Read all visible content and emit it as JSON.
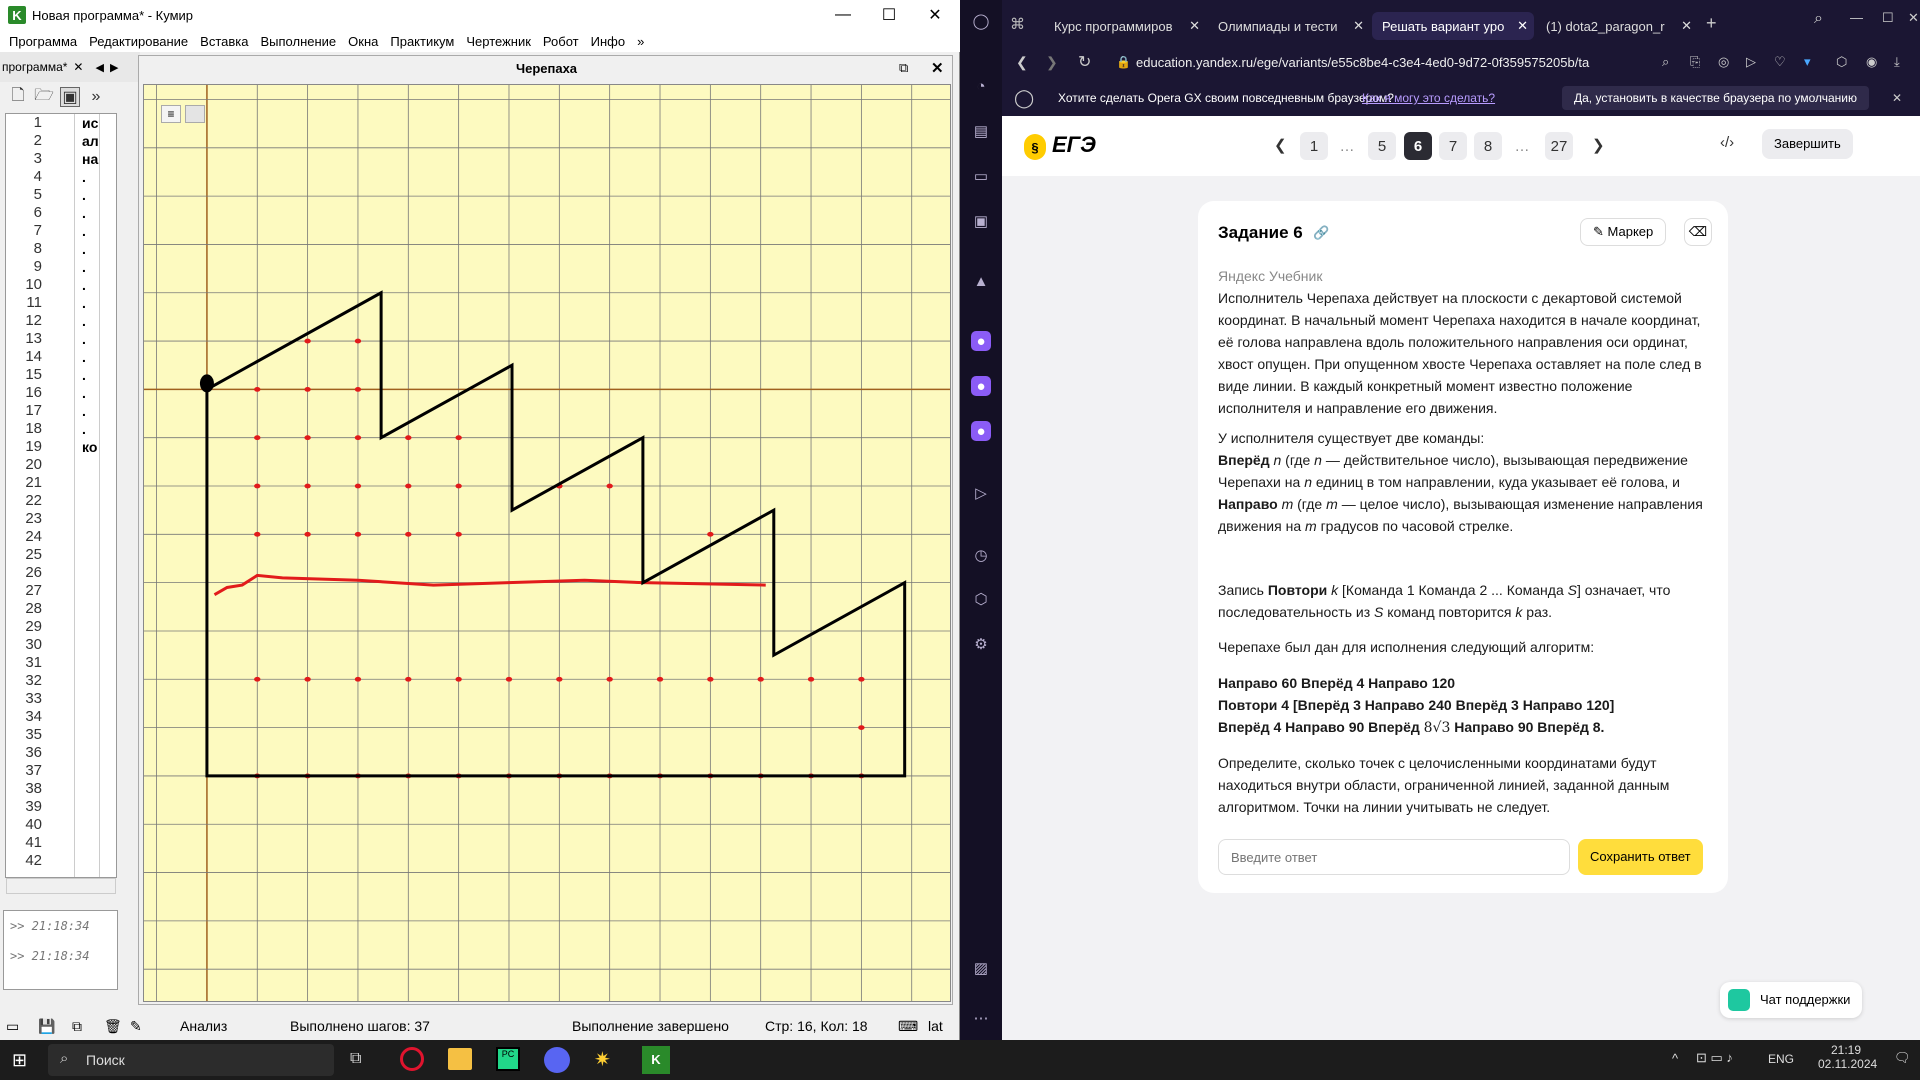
{
  "kumir": {
    "title": "Новая программа* - Кумир",
    "menu": [
      "Программа",
      "Редактирование",
      "Вставка",
      "Выполнение",
      "Окна",
      "Практикум",
      "Чертежник",
      "Робот",
      "Инфо",
      "»"
    ],
    "tab_label": "программа*",
    "line_numbers": [
      "1",
      "2",
      "3",
      "4",
      "5",
      "6",
      "7",
      "8",
      "9",
      "10",
      "11",
      "12",
      "13",
      "14",
      "15",
      "16",
      "17",
      "18",
      "19",
      "20",
      "21",
      "22",
      "23",
      "24",
      "25",
      "26",
      "27",
      "28",
      "29",
      "30",
      "31",
      "32",
      "33",
      "34",
      "35",
      "36",
      "37",
      "38",
      "39",
      "40",
      "41",
      "42"
    ],
    "code_lines": [
      "ис",
      "ал",
      "на",
      ".",
      ".",
      ".",
      ".",
      ".",
      ".",
      ".",
      ".",
      ".",
      ".",
      ".",
      ".",
      ".",
      ".",
      ".",
      "ко"
    ],
    "console_lines": [
      ">> 21:18:34",
      ">> 21:18:34"
    ],
    "turtle_panel_title": "Черепаха",
    "status": {
      "mode": "Анализ",
      "steps": "Выполнено шагов: 37",
      "state": "Выполнение завершено",
      "cursor": "Стр: 16, Кол: 18",
      "layout": "lat"
    }
  },
  "turtle_canvas": {
    "grid_step": 1,
    "origin": [
      0,
      0
    ],
    "x_range": [
      -1.25,
      14.8
    ],
    "y_range": [
      -12.7,
      6.3
    ],
    "path": [
      [
        0,
        0
      ],
      [
        3.46,
        2
      ],
      [
        3.46,
        -1
      ],
      [
        6.06,
        0.5
      ],
      [
        6.06,
        -2.5
      ],
      [
        8.66,
        -1
      ],
      [
        8.66,
        -4
      ],
      [
        11.26,
        -2.5
      ],
      [
        11.26,
        -5.5
      ],
      [
        13.86,
        -4
      ],
      [
        13.86,
        -8
      ],
      [
        0,
        -8
      ],
      [
        0,
        0
      ]
    ],
    "marker_points": [
      [
        1,
        -8
      ],
      [
        2,
        -8
      ],
      [
        3,
        -8
      ],
      [
        4,
        -8
      ],
      [
        5,
        -8
      ],
      [
        6,
        -8
      ],
      [
        7,
        -8
      ],
      [
        8,
        -8
      ],
      [
        9,
        -8
      ],
      [
        10,
        -8
      ],
      [
        11,
        -8
      ],
      [
        12,
        -8
      ],
      [
        13,
        -8
      ],
      [
        13,
        -7
      ],
      [
        1,
        -6
      ],
      [
        2,
        -6
      ],
      [
        3,
        -6
      ],
      [
        4,
        -6
      ],
      [
        5,
        -6
      ],
      [
        6,
        -6
      ],
      [
        7,
        -6
      ],
      [
        8,
        -6
      ],
      [
        9,
        -6
      ],
      [
        10,
        -6
      ],
      [
        11,
        -6
      ],
      [
        12,
        -6
      ],
      [
        13,
        -6
      ],
      [
        1,
        -3
      ],
      [
        2,
        -3
      ],
      [
        3,
        -3
      ],
      [
        4,
        -3
      ],
      [
        5,
        -3
      ],
      [
        1,
        -2
      ],
      [
        2,
        -2
      ],
      [
        3,
        -2
      ],
      [
        4,
        -2
      ],
      [
        5,
        -2
      ],
      [
        7,
        -2
      ],
      [
        1,
        -1
      ],
      [
        2,
        -1
      ],
      [
        3,
        -1
      ],
      [
        4,
        -1
      ],
      [
        5,
        -1
      ],
      [
        1,
        0
      ],
      [
        2,
        0
      ],
      [
        3,
        0
      ],
      [
        2,
        1
      ],
      [
        3,
        1
      ],
      [
        10,
        -3
      ],
      [
        7,
        -2
      ],
      [
        8,
        -2
      ]
    ]
  },
  "opera": {
    "tabs": [
      "Курс программиров",
      "Олимпиады и тести",
      "Решать вариант уро",
      "(1) dota2_paragon_r"
    ],
    "address": "education.yandex.ru/ege/variants/e55c8be4-c3e4-4ed0-9d72-0f359575205b/ta",
    "banner": {
      "question": "Хотите сделать Opera GX своим повседневным браузером?",
      "link": "Как я могу это сделать?",
      "button": "Да, установить в качестве браузера по умолчанию"
    }
  },
  "yandex": {
    "logo_text": "ЕГЭ",
    "pages": [
      "1",
      "…",
      "5",
      "6",
      "7",
      "8",
      "…",
      "27"
    ],
    "active_page": "6",
    "finish_label": "Завершить",
    "task_title": "Задание 6",
    "marker_label": "Маркер",
    "source": "Яндекс Учебник",
    "p1": "Исполнитель Черепаха действует на плоскости с декартовой системой координат. В начальный момент Черепаха находится в начале координат, её голова направлена вдоль положительного направления оси ординат, хвост опущен. При опущенном хвосте Черепаха оставляет на поле след в виде линии. В каждый конкретный момент известно положение исполнителя и направление его движения.",
    "p2_intro": "У исполнителя существует две команды:",
    "p2_fwd_cmd": "Вперёд",
    "p2_fwd_var": "n",
    "p2_fwd_desc_a": "(где",
    "p2_fwd_desc_b": "— действительное число), вызывающая передвижение Черепахи на",
    "p2_fwd_desc_c": "единиц в том направлении, куда указывает её голова, и",
    "p2_turn_cmd": "Направо",
    "p2_turn_var": "m",
    "p2_turn_desc_a": "(где",
    "p2_turn_desc_b": "— целое число), вызывающая изменение направления движения на",
    "p2_turn_desc_c": "градусов по часовой стрелке.",
    "p3_a": "Запись",
    "p3_cmd": "Повтори",
    "p3_k": "k",
    "p3_b": "[Команда 1 Команда 2 ... Команда",
    "p3_s": "S",
    "p3_c": "] означает, что последовательность из",
    "p3_d": "команд повторится",
    "p3_e": "раз.",
    "p4": "Черепахе был дан для исполнения следующий алгоритм:",
    "alg1": "Направо 60 Вперёд 4 Направо 120",
    "alg2": "Повтори 4 [Вперёд 3 Направо 240 Вперёд 3 Направо 120]",
    "alg3_a": "Вперёд 4 Направо 90 Вперёд",
    "alg3_math": "8√3",
    "alg3_b": "Направо 90 Вперёд 8.",
    "p5": "Определите, сколько точек с целочисленными координатами будут находиться внутри области, ограниченной линией, заданной данным алгоритмом. Точки на линии учитывать не следует.",
    "answer_placeholder": "Введите ответ",
    "save_label": "Сохранить ответ",
    "support_label": "Чат поддержки"
  },
  "taskbar": {
    "search_label": "Поиск",
    "lang": "ENG",
    "time": "21:19",
    "date": "02.11.2024"
  },
  "colors": {
    "canvas_bg": "#fdfac0",
    "line": "#000000",
    "marker": "#e21b1b",
    "axis": "#a0601e",
    "accent": "#ffdd3c",
    "opera_dark": "#1b1633"
  }
}
